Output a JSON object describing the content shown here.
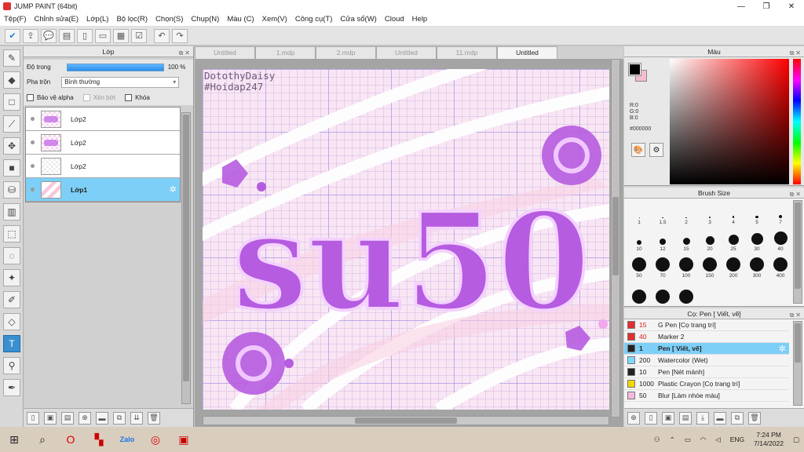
{
  "app": {
    "title": "JUMP PAINT (64bit)"
  },
  "window_controls": {
    "minimize": "—",
    "maximize": "❐",
    "close": "✕"
  },
  "menu": [
    "Tệp(F)",
    "Chỉnh sửa(E)",
    "Lớp(L)",
    "Bộ lọc(R)",
    "Chọn(S)",
    "Chụp(N)",
    "Màu (C)",
    "Xem(V)",
    "Công cụ(T)",
    "Cửa sổ(W)",
    "Cloud",
    "Help"
  ],
  "layer_panel": {
    "title": "Lớp",
    "opacity_label": "Độ trong",
    "opacity_value": "100 %",
    "blend_label": "Pha trộn",
    "blend_value": "Bình thường",
    "protect_alpha": "Bảo vệ alpha",
    "clip": "Xén bớt",
    "lock": "Khóa",
    "layers": [
      {
        "name": "Lớp2"
      },
      {
        "name": "Lớp2"
      },
      {
        "name": "Lớp2"
      },
      {
        "name": "Lớp1"
      }
    ]
  },
  "tabs": [
    "Untitled",
    "1.mdp",
    "2.mdp",
    "Untitled",
    "11.mdp",
    "Untitled"
  ],
  "canvas": {
    "signature": "DotothyDaisy\n#Hoidap247",
    "artwork_text": "su50"
  },
  "color_panel": {
    "title": "Màu",
    "r": "R:0",
    "g": "G:0",
    "b": "B:0",
    "hex": "#000000",
    "fg": "#000000",
    "bg": "#f6bcd0"
  },
  "brush_size": {
    "title": "Brush Size",
    "sizes": [
      "1",
      "1.5",
      "2",
      "3",
      "4",
      "5",
      "7",
      "10",
      "12",
      "15",
      "20",
      "25",
      "30",
      "40",
      "50",
      "70",
      "100",
      "150",
      "200",
      "300",
      "400",
      "",
      "",
      ""
    ]
  },
  "tools_panel": {
    "title": "Cọ: Pen [ Viết, vẽ]",
    "items": [
      {
        "size": "15",
        "name": "G Pen [Cọ trang trí]",
        "color": "#e03030"
      },
      {
        "size": "40",
        "name": "Marker 2",
        "color": "#e03030"
      },
      {
        "size": "1",
        "name": "Pen [ Viết, vẽ]",
        "color": "#222222"
      },
      {
        "size": "200",
        "name": "Watercolor (Wet)",
        "color": "#7fd8f8"
      },
      {
        "size": "10",
        "name": "Pen [Nét mảnh]",
        "color": "#222222"
      },
      {
        "size": "1000",
        "name": "Plastic Crayon [Cọ trang trí]",
        "color": "#f0d800"
      },
      {
        "size": "50",
        "name": "Blur [Làm nhòe màu]",
        "color": "#f4b8e0"
      }
    ]
  },
  "taskbar": {
    "lang": "ENG",
    "time": "7:24 PM",
    "date": "7/14/2022"
  }
}
